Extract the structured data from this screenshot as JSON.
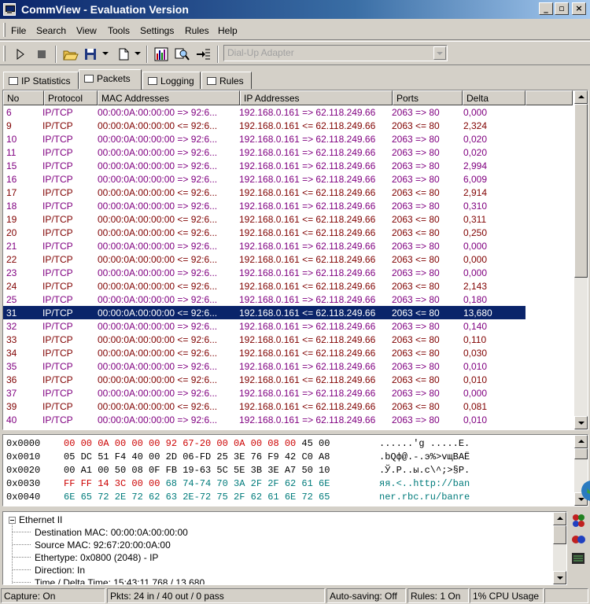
{
  "window": {
    "title": "CommView - Evaluation Version"
  },
  "menu": [
    "File",
    "Search",
    "View",
    "Tools",
    "Settings",
    "Rules",
    "Help"
  ],
  "toolbar": {
    "adapter": "Dial-Up Adapter"
  },
  "tabs": [
    "IP Statistics",
    "Packets",
    "Logging",
    "Rules"
  ],
  "packets": {
    "columns": [
      "No",
      "Protocol",
      "MAC Addresses",
      "IP Addresses",
      "Ports",
      "Delta"
    ],
    "rows": [
      {
        "no": "6",
        "proto": "IP/TCP",
        "mac": "00:00:0A:00:00:00 => 92:6...",
        "ip": "192.168.0.161 => 62.118.249.66",
        "ports": "2063 => 80",
        "delta": "0,000",
        "dir": "out"
      },
      {
        "no": "9",
        "proto": "IP/TCP",
        "mac": "00:00:0A:00:00:00 <= 92:6...",
        "ip": "192.168.0.161 <= 62.118.249.66",
        "ports": "2063 <= 80",
        "delta": "2,324",
        "dir": "in"
      },
      {
        "no": "10",
        "proto": "IP/TCP",
        "mac": "00:00:0A:00:00:00 => 92:6...",
        "ip": "192.168.0.161 => 62.118.249.66",
        "ports": "2063 => 80",
        "delta": "0,020",
        "dir": "out"
      },
      {
        "no": "11",
        "proto": "IP/TCP",
        "mac": "00:00:0A:00:00:00 => 92:6...",
        "ip": "192.168.0.161 => 62.118.249.66",
        "ports": "2063 => 80",
        "delta": "0,020",
        "dir": "out"
      },
      {
        "no": "15",
        "proto": "IP/TCP",
        "mac": "00:00:0A:00:00:00 => 92:6...",
        "ip": "192.168.0.161 => 62.118.249.66",
        "ports": "2063 => 80",
        "delta": "2,994",
        "dir": "out"
      },
      {
        "no": "16",
        "proto": "IP/TCP",
        "mac": "00:00:0A:00:00:00 => 92:6...",
        "ip": "192.168.0.161 => 62.118.249.66",
        "ports": "2063 => 80",
        "delta": "6,009",
        "dir": "out"
      },
      {
        "no": "17",
        "proto": "IP/TCP",
        "mac": "00:00:0A:00:00:00 <= 92:6...",
        "ip": "192.168.0.161 <= 62.118.249.66",
        "ports": "2063 <= 80",
        "delta": "2,914",
        "dir": "in"
      },
      {
        "no": "18",
        "proto": "IP/TCP",
        "mac": "00:00:0A:00:00:00 => 92:6...",
        "ip": "192.168.0.161 => 62.118.249.66",
        "ports": "2063 => 80",
        "delta": "0,310",
        "dir": "out"
      },
      {
        "no": "19",
        "proto": "IP/TCP",
        "mac": "00:00:0A:00:00:00 <= 92:6...",
        "ip": "192.168.0.161 <= 62.118.249.66",
        "ports": "2063 <= 80",
        "delta": "0,311",
        "dir": "in"
      },
      {
        "no": "20",
        "proto": "IP/TCP",
        "mac": "00:00:0A:00:00:00 <= 92:6...",
        "ip": "192.168.0.161 <= 62.118.249.66",
        "ports": "2063 <= 80",
        "delta": "0,250",
        "dir": "in"
      },
      {
        "no": "21",
        "proto": "IP/TCP",
        "mac": "00:00:0A:00:00:00 => 92:6...",
        "ip": "192.168.0.161 => 62.118.249.66",
        "ports": "2063 => 80",
        "delta": "0,000",
        "dir": "out"
      },
      {
        "no": "22",
        "proto": "IP/TCP",
        "mac": "00:00:0A:00:00:00 <= 92:6...",
        "ip": "192.168.0.161 <= 62.118.249.66",
        "ports": "2063 <= 80",
        "delta": "0,000",
        "dir": "in"
      },
      {
        "no": "23",
        "proto": "IP/TCP",
        "mac": "00:00:0A:00:00:00 => 92:6...",
        "ip": "192.168.0.161 => 62.118.249.66",
        "ports": "2063 => 80",
        "delta": "0,000",
        "dir": "out"
      },
      {
        "no": "24",
        "proto": "IP/TCP",
        "mac": "00:00:0A:00:00:00 <= 92:6...",
        "ip": "192.168.0.161 <= 62.118.249.66",
        "ports": "2063 <= 80",
        "delta": "2,143",
        "dir": "in"
      },
      {
        "no": "25",
        "proto": "IP/TCP",
        "mac": "00:00:0A:00:00:00 => 92:6...",
        "ip": "192.168.0.161 => 62.118.249.66",
        "ports": "2063 => 80",
        "delta": "0,180",
        "dir": "out"
      },
      {
        "no": "31",
        "proto": "IP/TCP",
        "mac": "00:00:0A:00:00:00 <= 92:6...",
        "ip": "192.168.0.161 <= 62.118.249.66",
        "ports": "2063 <= 80",
        "delta": "13,680",
        "dir": "in",
        "selected": true
      },
      {
        "no": "32",
        "proto": "IP/TCP",
        "mac": "00:00:0A:00:00:00 => 92:6...",
        "ip": "192.168.0.161 => 62.118.249.66",
        "ports": "2063 => 80",
        "delta": "0,140",
        "dir": "out"
      },
      {
        "no": "33",
        "proto": "IP/TCP",
        "mac": "00:00:0A:00:00:00 <= 92:6...",
        "ip": "192.168.0.161 <= 62.118.249.66",
        "ports": "2063 <= 80",
        "delta": "0,110",
        "dir": "in"
      },
      {
        "no": "34",
        "proto": "IP/TCP",
        "mac": "00:00:0A:00:00:00 <= 92:6...",
        "ip": "192.168.0.161 <= 62.118.249.66",
        "ports": "2063 <= 80",
        "delta": "0,030",
        "dir": "in"
      },
      {
        "no": "35",
        "proto": "IP/TCP",
        "mac": "00:00:0A:00:00:00 => 92:6...",
        "ip": "192.168.0.161 => 62.118.249.66",
        "ports": "2063 => 80",
        "delta": "0,010",
        "dir": "out"
      },
      {
        "no": "36",
        "proto": "IP/TCP",
        "mac": "00:00:0A:00:00:00 <= 92:6...",
        "ip": "192.168.0.161 <= 62.118.249.66",
        "ports": "2063 <= 80",
        "delta": "0,010",
        "dir": "in"
      },
      {
        "no": "37",
        "proto": "IP/TCP",
        "mac": "00:00:0A:00:00:00 => 92:6...",
        "ip": "192.168.0.161 => 62.118.249.66",
        "ports": "2063 => 80",
        "delta": "0,000",
        "dir": "out"
      },
      {
        "no": "39",
        "proto": "IP/TCP",
        "mac": "00:00:0A:00:00:00 <= 92:6...",
        "ip": "192.168.0.161 <= 62.118.249.66",
        "ports": "2063 <= 80",
        "delta": "0,081",
        "dir": "in"
      },
      {
        "no": "40",
        "proto": "IP/TCP",
        "mac": "00:00:0A:00:00:00 => 92:6...",
        "ip": "192.168.0.161 => 62.118.249.66",
        "ports": "2063 => 80",
        "delta": "0,010",
        "dir": "out"
      }
    ]
  },
  "hex": [
    {
      "offset": "0x0000",
      "bytes": [
        [
          "00 00 0A 00 00 00 92 67-20 00 0A 00 08 00",
          "#cc0000"
        ],
        [
          "45 00",
          "#000000"
        ]
      ],
      "ascii": "......'g .....E."
    },
    {
      "offset": "0x0010",
      "bytes": [
        [
          "05 DC 51 F4 40 00 2D 06-FD 25 3E 76 F9 42 C0 A8",
          "#000000"
        ]
      ],
      "ascii": ".bQф@.-.э%>vщВАЁ"
    },
    {
      "offset": "0x0020",
      "bytes": [
        [
          "00 A1 00 50 08 0F FB 19-63 5C 5E 3B 3E A7 50 10",
          "#000000"
        ]
      ],
      "ascii": ".Ў.P..ы.c\\^;>§P."
    },
    {
      "offset": "0x0030",
      "bytes": [
        [
          "FF FF 14 3C 00 00",
          "#cc0000"
        ],
        [
          "68 74-74 70 3A 2F 2F 62 61 6E",
          "#007b7b"
        ]
      ],
      "ascii": "яя.<..http://ban"
    },
    {
      "offset": "0x0040",
      "bytes": [
        [
          "6E 65 72 2E 72 62 63 2E-72 75 2F 62 61 6E 72 65",
          "#007b7b"
        ]
      ],
      "ascii": "ner.rbc.ru/banre"
    }
  ],
  "details": {
    "root": "Ethernet II",
    "items": [
      "Destination MAC: 00:00:0A:00:00:00",
      "Source MAC: 92:67:20:00:0A:00",
      "Ethertype: 0x0800 (2048) - IP",
      "Direction: In",
      "Time / Delta Time: 15:43:11.768 / 13.680"
    ]
  },
  "status": [
    "Capture: On",
    "Pkts: 24 in / 40 out / 0 pass",
    "Auto-saving: Off",
    "Rules: 1 On",
    "1% CPU Usage"
  ],
  "colors": {
    "in": "#800000",
    "out": "#800080",
    "selected": "#0a246a"
  }
}
